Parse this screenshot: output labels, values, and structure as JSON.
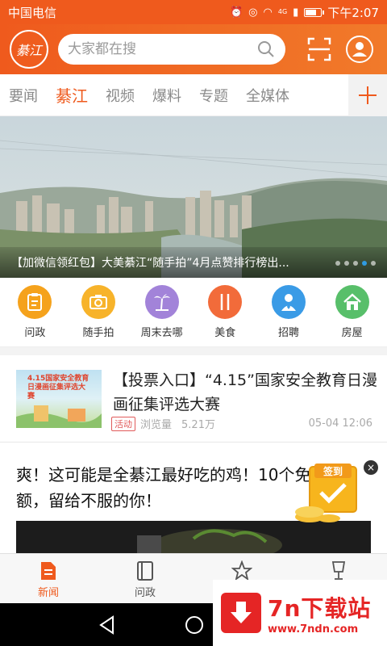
{
  "status_bar": {
    "carrier": "中国电信",
    "network": "4G",
    "time": "下午2:07",
    "battery_level": 0.7
  },
  "header": {
    "logo_text": "綦江",
    "search_placeholder": "大家都在搜"
  },
  "tabs": [
    {
      "label": "要闻",
      "active": false
    },
    {
      "label": "綦江",
      "active": true
    },
    {
      "label": "视频",
      "active": false
    },
    {
      "label": "爆料",
      "active": false
    },
    {
      "label": "专题",
      "active": false
    },
    {
      "label": "全媒体",
      "active": false
    }
  ],
  "banner": {
    "caption": "【加微信领红包】大美綦江“随手拍”4月点赞排行榜出...",
    "slide_count": 5,
    "active_slide": 3
  },
  "quick_menu": [
    {
      "label": "问政",
      "icon": "clipboard-icon",
      "color": "#f5a21c"
    },
    {
      "label": "随手拍",
      "icon": "camera-icon",
      "color": "#f7b32a"
    },
    {
      "label": "周末去哪",
      "icon": "palm-tree-icon",
      "color": "#a283d9"
    },
    {
      "label": "美食",
      "icon": "cutlery-icon",
      "color": "#f26b3a"
    },
    {
      "label": "招聘",
      "icon": "person-icon",
      "color": "#3a9be6"
    },
    {
      "label": "房屋",
      "icon": "house-icon",
      "color": "#58bf6a"
    }
  ],
  "articles": [
    {
      "title": "【投票入口】“4.15”国家安全教育日漫画征集评选大赛",
      "tag": "活动",
      "views_label": "浏览量",
      "views": "5.21万",
      "date": "05-04 12:06",
      "thumb_text": "4.15国家安全教育日漫画征集评选大赛"
    },
    {
      "title": "爽！这可能是全綦江最好吃的鸡！10个免单名额，留给不服的你！"
    }
  ],
  "signin_widget": {
    "label": "签到",
    "close": "×"
  },
  "bottom_nav": [
    {
      "label": "新闻",
      "icon": "news-icon",
      "active": true
    },
    {
      "label": "问政",
      "icon": "book-icon",
      "active": false
    },
    {
      "label": "",
      "icon": "star-icon",
      "active": false
    },
    {
      "label": "",
      "icon": "cup-icon",
      "active": false
    }
  ],
  "watermark": {
    "name": "7n下载站",
    "url": "www.7ndn.com"
  },
  "colors": {
    "brand": "#ef5a1d",
    "active_dot": "#2f9be0"
  }
}
